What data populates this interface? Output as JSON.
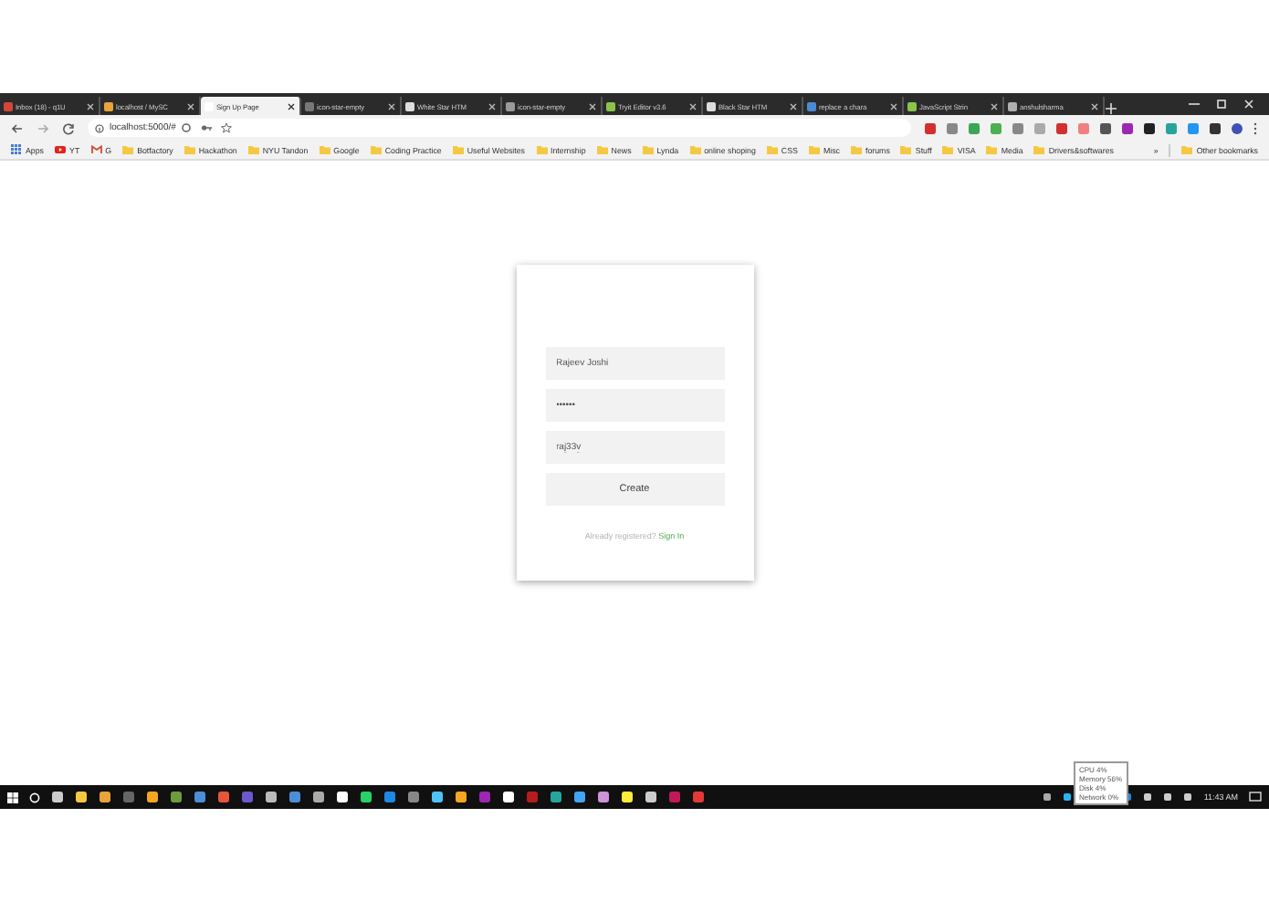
{
  "tabs": [
    {
      "title": "Inbox (18) - q1U",
      "selected": false
    },
    {
      "title": "localhost / MySC",
      "selected": false
    },
    {
      "title": "Sign Up Page",
      "selected": true
    },
    {
      "title": "icon-star-empty",
      "selected": false
    },
    {
      "title": "White Star HTM",
      "selected": false
    },
    {
      "title": "icon-star-empty",
      "selected": false
    },
    {
      "title": "Tryit Editor v3.6",
      "selected": false
    },
    {
      "title": "Black Star HTM",
      "selected": false
    },
    {
      "title": "replace a chara",
      "selected": false
    },
    {
      "title": "JavaScript Strin",
      "selected": false
    },
    {
      "title": "anshulsharma",
      "selected": false
    }
  ],
  "address": "localhost:5000/#",
  "bookmarks": [
    {
      "label": "Apps",
      "kind": "apps"
    },
    {
      "label": "YT",
      "kind": "video"
    },
    {
      "label": "G",
      "kind": "mail"
    },
    {
      "label": "Botfactory",
      "kind": "folder"
    },
    {
      "label": "Hackathon",
      "kind": "folder"
    },
    {
      "label": "NYU Tandon",
      "kind": "folder"
    },
    {
      "label": "Google",
      "kind": "folder"
    },
    {
      "label": "Coding Practice",
      "kind": "folder"
    },
    {
      "label": "Useful Websites",
      "kind": "folder"
    },
    {
      "label": "Internship",
      "kind": "folder"
    },
    {
      "label": "News",
      "kind": "folder"
    },
    {
      "label": "Lynda",
      "kind": "folder"
    },
    {
      "label": "online shoping",
      "kind": "folder"
    },
    {
      "label": "CSS",
      "kind": "folder"
    },
    {
      "label": "Misc",
      "kind": "folder"
    },
    {
      "label": "forums",
      "kind": "folder"
    },
    {
      "label": "Stuff",
      "kind": "folder"
    },
    {
      "label": "VISA",
      "kind": "folder"
    },
    {
      "label": "Media",
      "kind": "folder"
    },
    {
      "label": "Drivers&softwares",
      "kind": "folder"
    }
  ],
  "bookmarks_more": "»",
  "other_bookmarks": "Other bookmarks",
  "form": {
    "fields": [
      {
        "value": "Rajeev Joshi",
        "misspelled": false
      },
      {
        "value": "••••••",
        "misspelled": false
      },
      {
        "value": "raj33v",
        "misspelled": true
      }
    ],
    "button": "Create",
    "prompt": "Already registered?",
    "link": "Sign In"
  },
  "tooltip": [
    "CPU 4%",
    "Memory 56%",
    "Disk 4%",
    "Network 0%"
  ],
  "clock": "11:43 AM"
}
